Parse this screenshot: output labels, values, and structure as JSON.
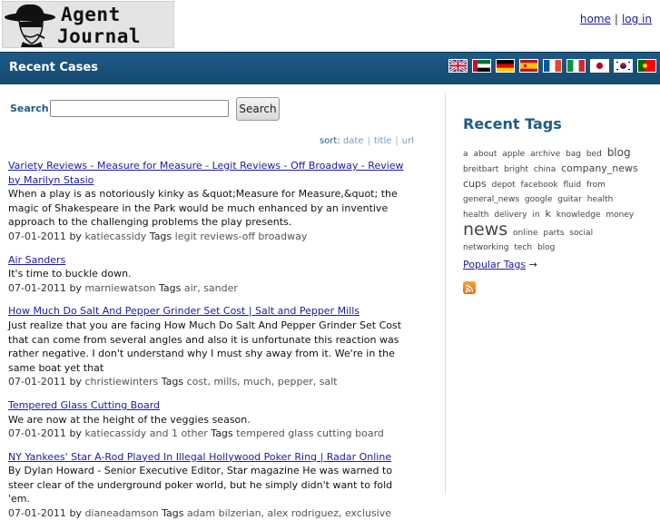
{
  "header": {
    "logo_line1": "Agent",
    "logo_line2": "Journal",
    "home_link": "home",
    "separator": "|",
    "login_link": "log in"
  },
  "bar": {
    "title": "Recent Cases",
    "flags": [
      "uk-flag-icon",
      "uae-flag-icon",
      "germany-flag-icon",
      "spain-flag-icon",
      "france-flag-icon",
      "italy-flag-icon",
      "japan-flag-icon",
      "korea-flag-icon",
      "portugal-flag-icon"
    ]
  },
  "search": {
    "label": "Search",
    "value": "",
    "button_label": "Search"
  },
  "sort": {
    "label": "sort:",
    "options": [
      "date",
      "title",
      "url"
    ]
  },
  "cases": [
    {
      "title": "Variety Reviews - Measure for Measure - Legit Reviews - Off Broadway - Review by Marilyn Stasio",
      "desc": "When a play is as notoriously kinky as &quot;Measure for Measure,&quot; the magic of Shakespeare in the Park would be much enhanced by an inventive approach to the challenging problems the play presents.",
      "date": "07-01-2011",
      "by": "by",
      "user": "katiecassidy",
      "extra": "",
      "tags_label": "Tags",
      "tags": "legit reviews-off broadway"
    },
    {
      "title": "Air Sanders",
      "desc": "It's time to buckle down.",
      "date": "07-01-2011",
      "by": "by",
      "user": "marniewatson",
      "extra": "",
      "tags_label": "Tags",
      "tags": "air, sander"
    },
    {
      "title": "How Much Do Salt And Pepper Grinder Set Cost | Salt and Pepper Mills",
      "desc": "Just realize that you are facing How Much Do Salt And Pepper Grinder Set Cost that can come from several angles and also it is unfortunate this reaction was rather negative. I don't understand why I must shy away from it. We're in the same boat yet that",
      "date": "07-01-2011",
      "by": "by",
      "user": "christiewinters",
      "extra": "",
      "tags_label": "Tags",
      "tags": "cost, mills, much, pepper, salt"
    },
    {
      "title": "Tempered Glass Cutting Board",
      "desc": "We are now at the height of the veggies season.",
      "date": "07-01-2011",
      "by": "by",
      "user": "katiecassidy",
      "extra": "and 1 other",
      "tags_label": "Tags",
      "tags": "tempered glass cutting board"
    },
    {
      "title": "NY Yankees' Star A-Rod Played In Illegal Hollywood Poker Ring | Radar Online",
      "desc": "By Dylan Howard - Senior Executive Editor, Star magazine He was warned to steer clear of the underground poker world, but he simply didn't want to fold 'em.",
      "date": "07-01-2011",
      "by": "by",
      "user": "dianeadamson",
      "extra": "",
      "tags_label": "Tags",
      "tags": "adam bilzerian, alex rodriguez, exclusive"
    }
  ],
  "sidebar": {
    "title": "Recent Tags",
    "tags": [
      {
        "text": "a",
        "size": 1
      },
      {
        "text": "about",
        "size": 1
      },
      {
        "text": "apple",
        "size": 1
      },
      {
        "text": "archive",
        "size": 1
      },
      {
        "text": "bag",
        "size": 1
      },
      {
        "text": "bed",
        "size": 1
      },
      {
        "text": "blog",
        "size": 3
      },
      {
        "text": "breitbart",
        "size": 1
      },
      {
        "text": "bright",
        "size": 1
      },
      {
        "text": "china",
        "size": 1
      },
      {
        "text": "company_news",
        "size": 2
      },
      {
        "text": "cups",
        "size": 2
      },
      {
        "text": "depot",
        "size": 1
      },
      {
        "text": "facebook",
        "size": 1
      },
      {
        "text": "fluid",
        "size": 1
      },
      {
        "text": "from",
        "size": 1
      },
      {
        "text": "general_news",
        "size": 1
      },
      {
        "text": "google",
        "size": 1
      },
      {
        "text": "guitar",
        "size": 1
      },
      {
        "text": "health",
        "size": 1
      },
      {
        "text": "health",
        "size": 1
      },
      {
        "text": "delivery",
        "size": 1
      },
      {
        "text": "in",
        "size": 1
      },
      {
        "text": "k",
        "size": 2
      },
      {
        "text": "knowledge",
        "size": 1
      },
      {
        "text": "money",
        "size": 1
      },
      {
        "text": "news",
        "size": 4
      },
      {
        "text": "online",
        "size": 1
      },
      {
        "text": "parts",
        "size": 1
      },
      {
        "text": "social",
        "size": 1
      },
      {
        "text": "networking",
        "size": 1
      },
      {
        "text": "tech",
        "size": 1
      },
      {
        "text": "blog",
        "size": 1
      }
    ],
    "popular_link": "Popular Tags",
    "popular_arrow": "→"
  }
}
